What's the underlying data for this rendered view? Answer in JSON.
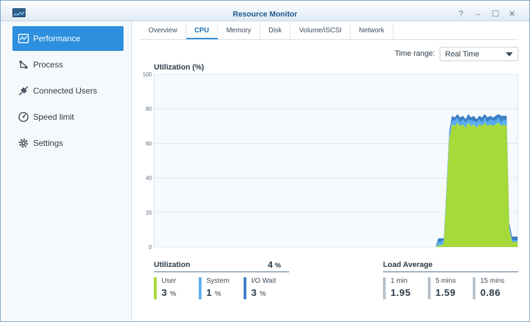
{
  "window": {
    "title": "Resource Monitor",
    "controls": [
      "?",
      "–",
      "☐",
      "✕"
    ]
  },
  "sidebar": {
    "items": [
      {
        "label": "Performance",
        "icon": "performance-icon",
        "active": true
      },
      {
        "label": "Process",
        "icon": "process-icon",
        "active": false
      },
      {
        "label": "Connected Users",
        "icon": "connected-users-icon",
        "active": false
      },
      {
        "label": "Speed limit",
        "icon": "speed-limit-icon",
        "active": false
      },
      {
        "label": "Settings",
        "icon": "gear-icon",
        "active": false
      }
    ]
  },
  "tabs": [
    "Overview",
    "CPU",
    "Memory",
    "Disk",
    "Volume/iSCSI",
    "Network"
  ],
  "active_tab": "CPU",
  "time_range": {
    "label": "Time range:",
    "value": "Real Time"
  },
  "chart": {
    "title": "Utilization (%)"
  },
  "utilization": {
    "title": "Utilization",
    "total": "4",
    "total_unit": "%",
    "items": [
      {
        "label": "User",
        "value": "3",
        "unit": "%",
        "color": "#a6d93a"
      },
      {
        "label": "System",
        "value": "1",
        "unit": "%",
        "color": "#5aaef0"
      },
      {
        "label": "I/O Wait",
        "value": "3",
        "unit": "%",
        "color": "#3b7fc6"
      }
    ]
  },
  "load_average": {
    "title": "Load Average",
    "items": [
      {
        "label": "1 min",
        "value": "1.95"
      },
      {
        "label": "5 mins",
        "value": "1.59"
      },
      {
        "label": "15 mins",
        "value": "0.86"
      }
    ]
  },
  "colors": {
    "accent": "#2d8fdd",
    "user": "#a6d93a",
    "system": "#5aaef0",
    "iowait": "#3b7fc6"
  },
  "chart_data": {
    "type": "area",
    "title": "Utilization (%)",
    "ylim": [
      0,
      100
    ],
    "yticks": [
      0,
      20,
      40,
      60,
      80,
      100
    ],
    "grid": true,
    "series": [
      {
        "name": "User",
        "values": [
          0,
          0,
          0,
          0,
          0,
          0,
          0,
          0,
          0,
          0,
          0,
          0,
          0,
          0,
          0,
          0,
          0,
          0,
          0,
          0,
          0,
          0,
          0,
          0,
          0,
          0,
          0,
          0,
          0,
          0,
          0,
          0,
          0,
          0,
          0,
          0,
          0,
          0,
          0,
          0,
          0,
          0,
          0,
          0,
          0,
          0,
          0,
          0,
          0,
          0,
          0,
          0,
          0,
          0,
          0,
          0,
          0,
          0,
          0,
          0,
          0,
          0,
          0,
          0,
          0,
          0,
          0,
          0,
          0,
          0,
          0,
          0,
          0,
          0,
          0,
          0,
          0,
          0,
          0,
          0,
          0,
          0,
          0,
          0,
          0,
          0,
          0,
          0,
          0,
          0,
          0,
          0,
          0,
          0,
          0,
          0,
          0,
          0,
          0,
          0,
          0,
          0,
          0,
          0,
          1,
          1,
          2,
          30,
          62,
          71,
          70,
          72,
          70,
          71,
          69,
          72,
          70,
          71,
          69,
          71,
          70,
          72,
          70,
          71,
          70,
          71,
          72,
          70,
          71,
          70,
          10,
          3,
          3,
          3
        ]
      },
      {
        "name": "System",
        "values": [
          0,
          0,
          0,
          0,
          0,
          0,
          0,
          0,
          0,
          0,
          0,
          0,
          0,
          0,
          0,
          0,
          0,
          0,
          0,
          0,
          0,
          0,
          0,
          0,
          0,
          0,
          0,
          0,
          0,
          0,
          0,
          0,
          0,
          0,
          0,
          0,
          0,
          0,
          0,
          0,
          0,
          0,
          0,
          0,
          0,
          0,
          0,
          0,
          0,
          0,
          0,
          0,
          0,
          0,
          0,
          0,
          0,
          0,
          0,
          0,
          0,
          0,
          0,
          0,
          0,
          0,
          0,
          0,
          0,
          0,
          0,
          0,
          0,
          0,
          0,
          0,
          0,
          0,
          0,
          0,
          0,
          0,
          0,
          0,
          0,
          0,
          0,
          0,
          0,
          0,
          0,
          0,
          0,
          0,
          0,
          0,
          0,
          0,
          0,
          0,
          0,
          0,
          0,
          0,
          2,
          2,
          2,
          3,
          3,
          2,
          3,
          3,
          2,
          3,
          3,
          2,
          3,
          2,
          3,
          3,
          2,
          3,
          2,
          3,
          3,
          2,
          3,
          2,
          3,
          3,
          2,
          1,
          1,
          1
        ]
      },
      {
        "name": "I/O Wait",
        "values": [
          0,
          0,
          0,
          0,
          0,
          0,
          0,
          0,
          0,
          0,
          0,
          0,
          0,
          0,
          0,
          0,
          0,
          0,
          0,
          0,
          0,
          0,
          0,
          0,
          0,
          0,
          0,
          0,
          0,
          0,
          0,
          0,
          0,
          0,
          0,
          0,
          0,
          0,
          0,
          0,
          0,
          0,
          0,
          0,
          0,
          0,
          0,
          0,
          0,
          0,
          0,
          0,
          0,
          0,
          0,
          0,
          0,
          0,
          0,
          0,
          0,
          0,
          0,
          0,
          0,
          0,
          0,
          0,
          0,
          0,
          0,
          0,
          0,
          0,
          0,
          0,
          0,
          0,
          0,
          0,
          0,
          0,
          0,
          0,
          0,
          0,
          0,
          0,
          0,
          0,
          0,
          0,
          0,
          0,
          0,
          0,
          0,
          0,
          0,
          0,
          0,
          0,
          0,
          0,
          2,
          2,
          1,
          2,
          2,
          3,
          2,
          2,
          3,
          2,
          2,
          3,
          2,
          3,
          2,
          2,
          3,
          2,
          3,
          2,
          2,
          3,
          2,
          4,
          2,
          3,
          2,
          2,
          2,
          2
        ]
      }
    ]
  }
}
